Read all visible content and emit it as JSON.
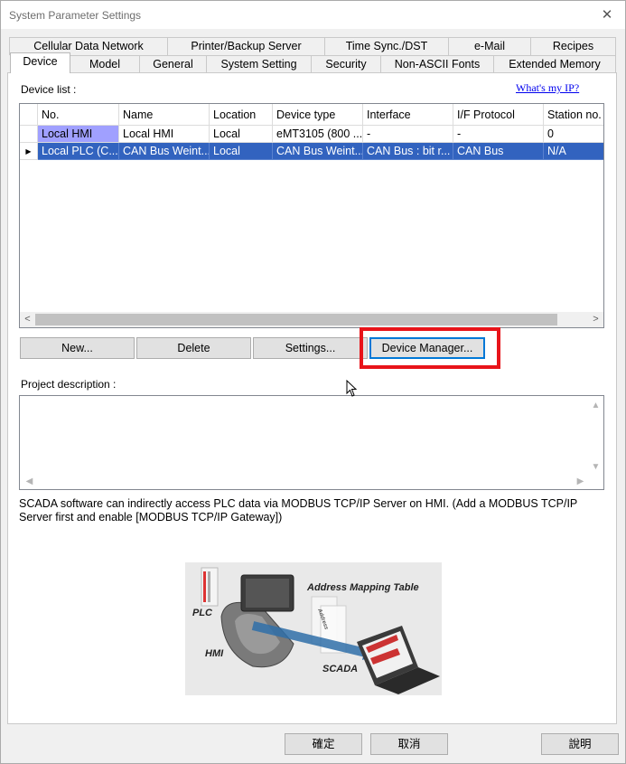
{
  "window": {
    "title": "System Parameter Settings",
    "close_glyph": "✕"
  },
  "tabs_row1": [
    {
      "label": "Cellular Data Network"
    },
    {
      "label": "Printer/Backup Server"
    },
    {
      "label": "Time Sync./DST"
    },
    {
      "label": "e-Mail"
    },
    {
      "label": "Recipes"
    }
  ],
  "tabs_row2": [
    {
      "label": "Device",
      "active": true
    },
    {
      "label": "Model"
    },
    {
      "label": "General"
    },
    {
      "label": "System Setting"
    },
    {
      "label": "Security"
    },
    {
      "label": "Non-ASCII Fonts"
    },
    {
      "label": "Extended Memory"
    }
  ],
  "device_list": {
    "label": "Device list :",
    "whats_my_ip": "What's my IP?",
    "columns": [
      "No.",
      "Name",
      "Location",
      "Device type",
      "Interface",
      "I/F Protocol",
      "Station no."
    ],
    "rows": [
      {
        "cells": [
          "Local HMI",
          "Local HMI",
          "Local",
          "eMT3105 (800 ...",
          "-",
          "-",
          "0"
        ],
        "selected": false
      },
      {
        "cells": [
          "Local PLC (C...",
          "CAN Bus Weint...",
          "Local",
          "CAN Bus Weint...",
          "CAN Bus : bit r...",
          "CAN Bus",
          "N/A"
        ],
        "selected": true
      }
    ],
    "row_pointer_glyph": "▶",
    "scroll_left_glyph": "<",
    "scroll_right_glyph": ">"
  },
  "buttons": {
    "new": "New...",
    "delete": "Delete",
    "settings": "Settings...",
    "device_manager": "Device Manager..."
  },
  "project_description": {
    "label": "Project description :",
    "value": ""
  },
  "info_text": "SCADA software can indirectly access PLC data via MODBUS TCP/IP Server on HMI. (Add a MODBUS TCP/IP Server first and enable [MODBUS TCP/IP Gateway])",
  "diagram": {
    "labels": {
      "address_mapping_table": "Address Mapping Table",
      "plc": "PLC",
      "hmi": "HMI",
      "scada": "SCADA",
      "address": "Address"
    }
  },
  "footer": {
    "ok": "確定",
    "cancel": "取消",
    "help": "說明"
  },
  "colors": {
    "selection": "#3263bf",
    "local_hmi_cell": "#a0a0ff",
    "highlight": "#e8141a"
  }
}
